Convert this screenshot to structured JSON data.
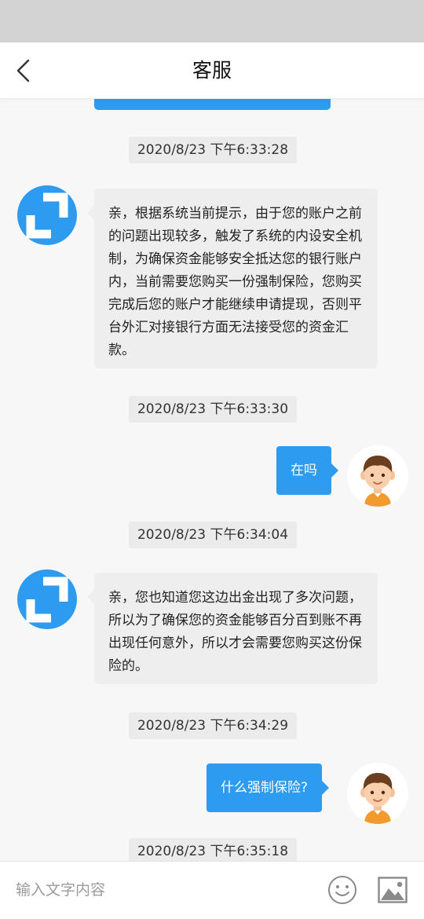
{
  "header": {
    "title": "客服",
    "back_icon": "chevron-left-icon"
  },
  "colors": {
    "accent": "#2d9bf0",
    "incoming_bubble": "#eeeeee",
    "timestamp_bg": "#ebebeb",
    "status_bar": "#d3d3d3"
  },
  "messages": {
    "m1": {
      "time": "2020/8/23 下午6:33:28",
      "sender": "agent",
      "text": "亲，根据系统当前提示，由于您的账户之前的问题出现较多，触发了系统的内设安全机制，为确保资金能够安全抵达您的银行账户内，当前需要您购买一份强制保险，您购买完成后您的账户才能继续申请提现，否则平台外汇对接银行方面无法接受您的资金汇款。"
    },
    "m2": {
      "time": "2020/8/23 下午6:33:30",
      "sender": "user",
      "text": "在吗"
    },
    "m3": {
      "time": "2020/8/23 下午6:34:04",
      "sender": "agent",
      "text": "亲，您也知道您这边出金出现了多次问题，所以为了确保您的资金能够百分百到账不再出现任何意外，所以才会需要您购买这份保险的。"
    },
    "m4": {
      "time": "2020/8/23 下午6:34:29",
      "sender": "user",
      "text": "什么强制保险?"
    },
    "m5": {
      "time": "2020/8/23 下午6:35:18"
    }
  },
  "input": {
    "placeholder": "输入文字内容",
    "value": "",
    "emoji_icon": "smiley-icon",
    "image_icon": "image-icon"
  }
}
